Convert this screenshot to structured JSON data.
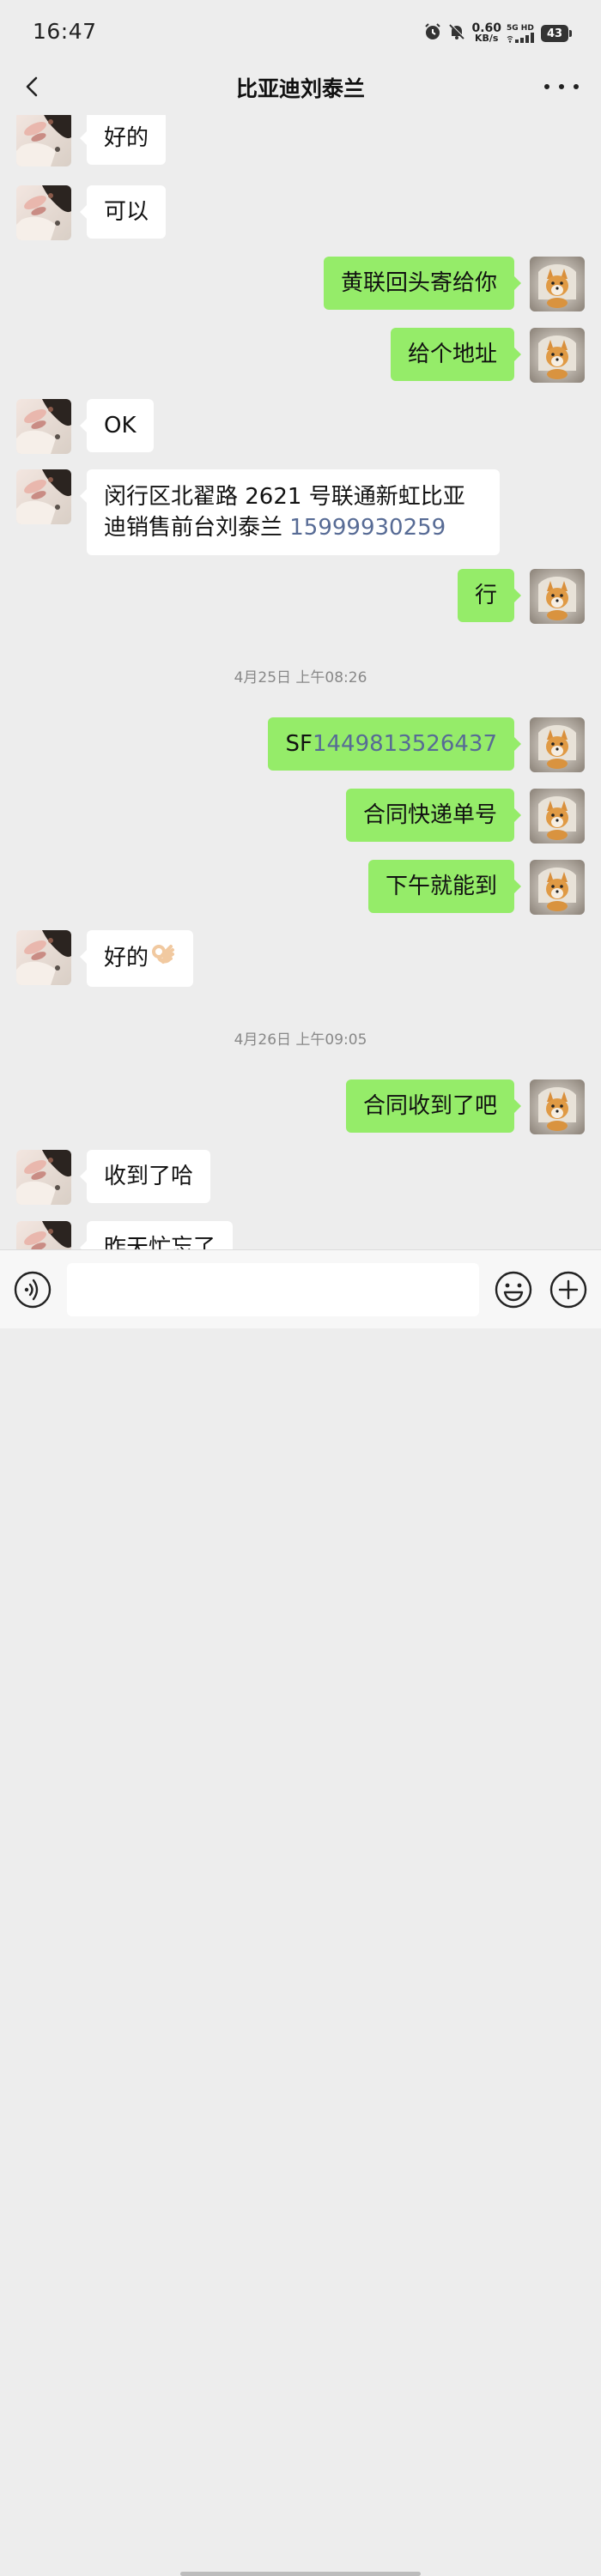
{
  "status_bar": {
    "time": "16:47",
    "net_speed_value": "0.60",
    "net_speed_unit": "KB/s",
    "network_label": "5G HD",
    "battery_level": "43",
    "icons": [
      "alarm-icon",
      "mute-bell-icon",
      "wifi-icon",
      "signal-icon",
      "battery-icon"
    ]
  },
  "header": {
    "title": "比亚迪刘泰兰",
    "back_icon": "chevron-left-icon",
    "more_icon": "more-dots-icon"
  },
  "messages": [
    {
      "sender": "contact",
      "text": "好的"
    },
    {
      "sender": "contact",
      "text": "可以"
    },
    {
      "sender": "me",
      "text": "黄联回头寄给你"
    },
    {
      "sender": "me",
      "text": "给个地址"
    },
    {
      "sender": "contact",
      "text": "OK"
    },
    {
      "sender": "contact",
      "text_prefix": "闵行区北翟路 2621 号联通新虹比亚迪销售前台刘泰兰 ",
      "link": "15999930259"
    },
    {
      "sender": "me",
      "text": "行"
    },
    {
      "type": "timestamp",
      "text": "4月25日 上午08:26"
    },
    {
      "sender": "me",
      "text_prefix": "SF",
      "link": "1449813526437"
    },
    {
      "sender": "me",
      "text": "合同快递单号"
    },
    {
      "sender": "me",
      "text": "下午就能到"
    },
    {
      "sender": "contact",
      "text": "好的",
      "emoji": "ok-hand-emoji"
    },
    {
      "type": "timestamp",
      "text": "4月26日 上午09:05"
    },
    {
      "sender": "me",
      "text": "合同收到了吧"
    },
    {
      "sender": "contact",
      "text": "收到了哈"
    },
    {
      "sender": "contact",
      "text": "昨天忙忘了"
    }
  ],
  "input_bar": {
    "voice_icon": "voice-icon",
    "input_value": "",
    "emoji_icon": "emoji-icon",
    "plus_icon": "plus-icon"
  },
  "colors": {
    "background": "#ededed",
    "outgoing_bubble": "#95ec69",
    "incoming_bubble": "#ffffff",
    "link": "#576b95",
    "timestamp": "#888888"
  }
}
